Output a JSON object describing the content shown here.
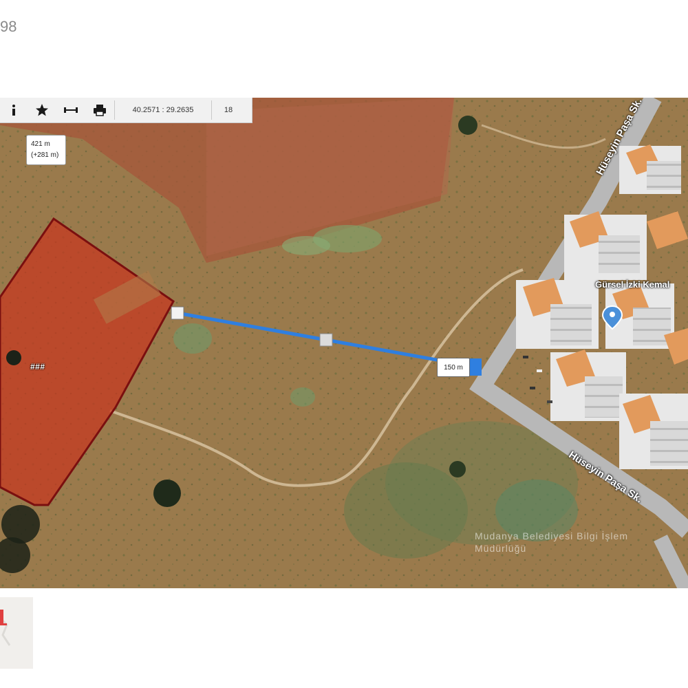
{
  "page": {
    "number_fragment": "98"
  },
  "toolbar": {
    "coordinates": "40.2571 : 29.2635",
    "zoom": "18",
    "icons": [
      "info-icon",
      "star-icon",
      "measure-icon",
      "print-icon"
    ]
  },
  "elevation_tooltip": {
    "line1": "421 m",
    "line2": "(+281 m)"
  },
  "parcel": {
    "label": "###"
  },
  "distance": {
    "label": "150 m"
  },
  "streets": {
    "street1": "Hüseyin Paşa Sk.",
    "street2": "Hüseyin Paşa Sk."
  },
  "poi": {
    "label": "Gürsel İzki Kemal"
  },
  "watermark": {
    "text": "Mudanya Belediyesi Bilgi İşlem Müdürlüğü"
  },
  "colors": {
    "parcel_fill": "#c8361f",
    "parcel_border": "#7a0f0f",
    "measure_line": "#2f7fe0",
    "poi_marker": "#4a90d9"
  }
}
